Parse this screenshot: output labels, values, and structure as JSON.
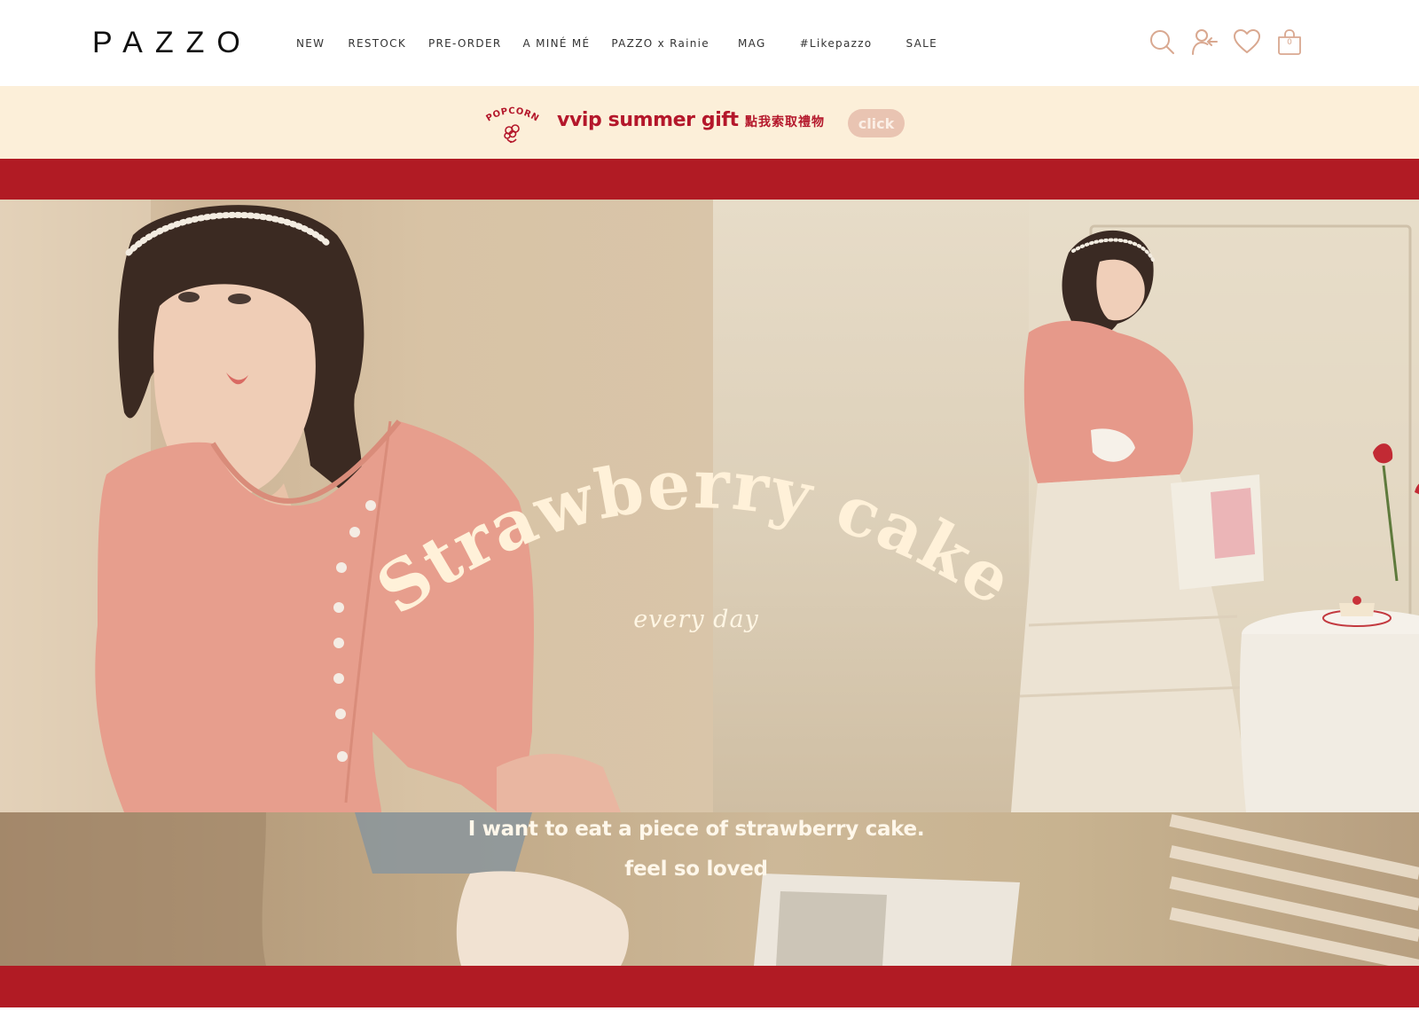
{
  "brand": {
    "logo": "PAZZO"
  },
  "nav": {
    "items": [
      "NEW",
      "RESTOCK",
      "PRE-ORDER",
      "A MINÉ MÉ",
      "PAZZO x Rainie",
      "MAG",
      "#Likepazzo",
      "SALE"
    ]
  },
  "header_icons": {
    "search": "search-icon",
    "account": "user-login-icon",
    "wishlist": "heart-icon",
    "cart": "shopping-bag-icon",
    "cart_count": "0",
    "icon_color": "#d9a890"
  },
  "promo": {
    "badge_text": "POPCORN",
    "title": "vvip summer gift",
    "subtitle": "點我索取禮物",
    "cta": "click",
    "background": "#fcefd9",
    "text_color": "#b4172b"
  },
  "hero": {
    "title": "Strawberry cake",
    "subtitle": "every day",
    "line1": "I want to eat a piece of strawberry cake.",
    "line2": "feel so loved",
    "band_color": "#b11b24",
    "title_color": "#fff1d9"
  }
}
